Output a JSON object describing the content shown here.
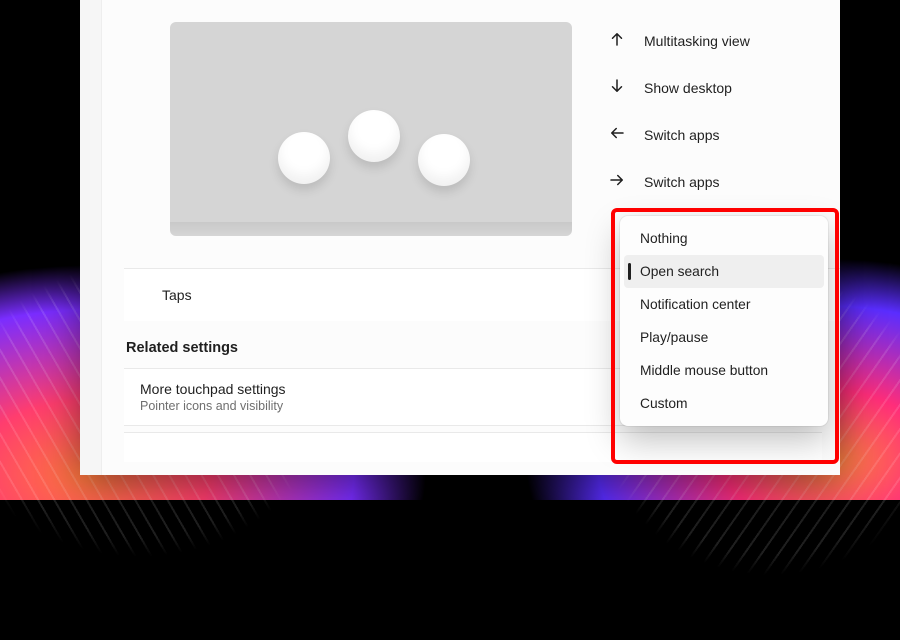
{
  "gestures": [
    {
      "icon": "arrow-up",
      "label": "Multitasking view"
    },
    {
      "icon": "arrow-down",
      "label": "Show desktop"
    },
    {
      "icon": "arrow-left",
      "label": "Switch apps"
    },
    {
      "icon": "arrow-right",
      "label": "Switch apps"
    }
  ],
  "taps_label": "Taps",
  "related_heading": "Related settings",
  "more": {
    "title": "More touchpad settings",
    "subtitle": "Pointer icons and visibility"
  },
  "dropdown": {
    "items": [
      "Nothing",
      "Open search",
      "Notification center",
      "Play/pause",
      "Middle mouse button",
      "Custom"
    ],
    "selected_index": 1
  }
}
